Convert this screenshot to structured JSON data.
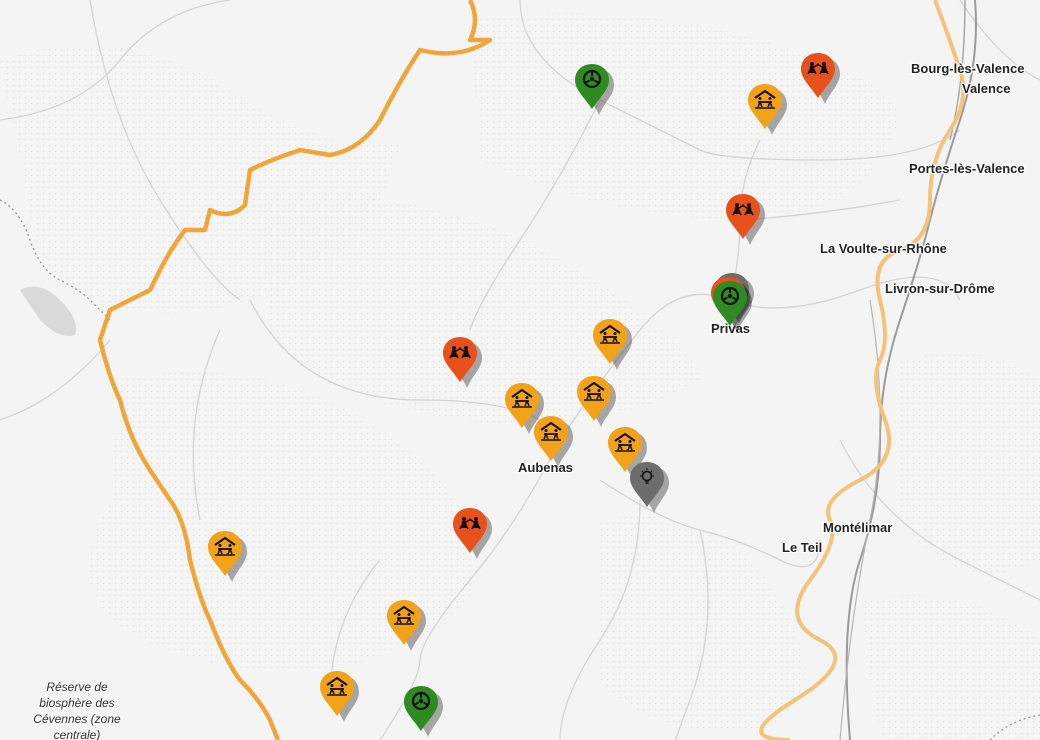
{
  "map": {
    "colors": {
      "background": "#f4f4f4",
      "roads": "#d6d6d6",
      "region_border": "#f2a73b",
      "river": "#f5c27a",
      "motorway": "#9a9a9a"
    },
    "cities": [
      {
        "name": "Bourg-lès-Valence"
      },
      {
        "name": "Valence"
      },
      {
        "name": "Portes-lès-Valence"
      },
      {
        "name": "La Voulte-sur-Rhône"
      },
      {
        "name": "Livron-sur-Drôme"
      },
      {
        "name": "Privas"
      },
      {
        "name": "Aubenas"
      },
      {
        "name": "Montélimar"
      },
      {
        "name": "Le Teil"
      }
    ],
    "reserve_label": {
      "lines": [
        "Réserve de",
        "biosphère des",
        "Cévennes (zone",
        "centrale)"
      ]
    },
    "markers": [
      {
        "category": "works",
        "color": "#e8501c",
        "icon": "road-workers-icon"
      },
      {
        "category": "shelter",
        "color": "#f2a218",
        "icon": "shelter-people-icon"
      },
      {
        "category": "nature",
        "color": "#2e8b22",
        "icon": "wheel-icon"
      },
      {
        "category": "idea",
        "color": "#6d6d6d",
        "icon": "lightbulb-icon"
      }
    ]
  }
}
